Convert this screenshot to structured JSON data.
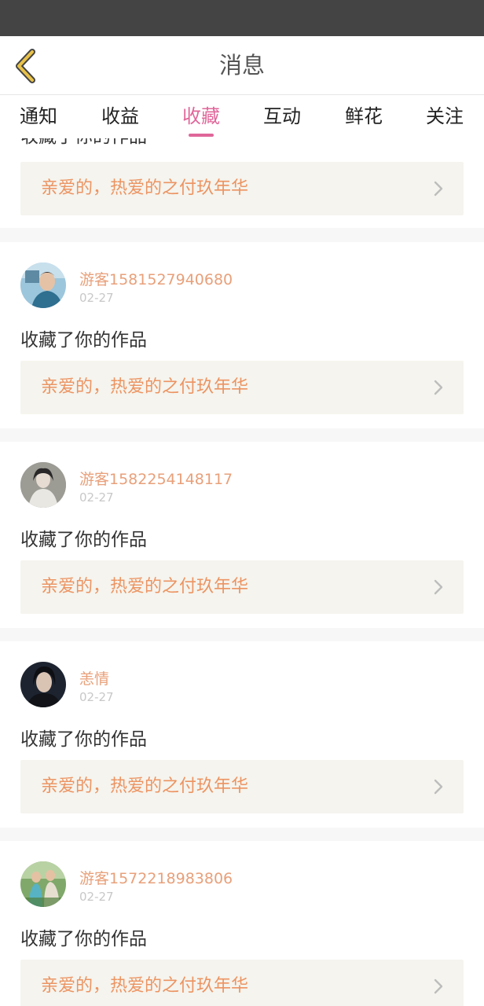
{
  "header": {
    "title": "消息"
  },
  "tabs": [
    {
      "label": "通知",
      "active": false
    },
    {
      "label": "收益",
      "active": false
    },
    {
      "label": "收藏",
      "active": true
    },
    {
      "label": "互动",
      "active": false
    },
    {
      "label": "鲜花",
      "active": false
    },
    {
      "label": "关注",
      "active": false
    }
  ],
  "partial_item": {
    "action": "收藏了你的作品",
    "work_title": "亲爱的，热爱的之付玖年华"
  },
  "messages": [
    {
      "user": "游客1581527940680",
      "date": "02-27",
      "action": "收藏了你的作品",
      "work_title": "亲爱的，热爱的之付玖年华"
    },
    {
      "user": "游客1582254148117",
      "date": "02-27",
      "action": "收藏了你的作品",
      "work_title": "亲爱的，热爱的之付玖年华"
    },
    {
      "user": "恙情",
      "date": "02-27",
      "action": "收藏了你的作品",
      "work_title": "亲爱的，热爱的之付玖年华"
    },
    {
      "user": "游客1572218983806",
      "date": "02-27",
      "action": "收藏了你的作品",
      "work_title": "亲爱的，热爱的之付玖年华"
    }
  ],
  "colors": {
    "accent": "#e0679a",
    "username": "#e8a07a",
    "work_title": "#ec9462",
    "work_bg": "#f5f4ee",
    "back_arrow": "#e8c24a"
  }
}
